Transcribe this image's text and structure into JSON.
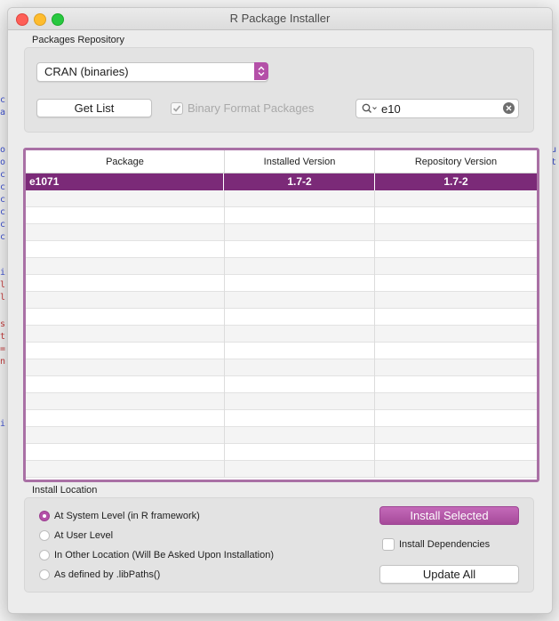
{
  "window": {
    "title": "R Package Installer"
  },
  "repository": {
    "group_label": "Packages Repository",
    "source_select": {
      "value": "CRAN (binaries)"
    },
    "get_list_label": "Get List",
    "binary_format_label": "Binary Format Packages",
    "binary_format_checked": true,
    "search": {
      "value": "e10"
    }
  },
  "packages_table": {
    "columns": [
      "Package",
      "Installed Version",
      "Repository Version"
    ],
    "rows": [
      {
        "package": "e1071",
        "installed": "1.7-2",
        "repository": "1.7-2",
        "selected": true
      }
    ]
  },
  "install_location": {
    "group_label": "Install Location",
    "options": [
      {
        "label": "At System Level (in R framework)",
        "selected": true
      },
      {
        "label": "At User Level",
        "selected": false
      },
      {
        "label": "In Other Location (Will Be Asked Upon Installation)",
        "selected": false
      },
      {
        "label": "As defined by .libPaths()",
        "selected": false
      }
    ],
    "install_selected_label": "Install Selected",
    "install_dependencies_label": "Install Dependencies",
    "install_dependencies_checked": false,
    "update_all_label": "Update All"
  },
  "colors": {
    "accent": "#b450a8",
    "selection": "#7b2a78",
    "table_border": "#a970a5"
  }
}
